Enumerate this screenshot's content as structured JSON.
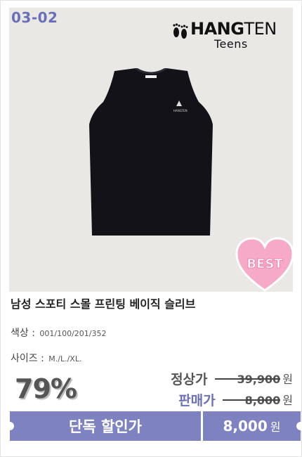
{
  "product": {
    "code": "03-02",
    "brand": {
      "main_prefix": "HANG",
      "main_suffix": "TEN",
      "sub": "Teens"
    },
    "badge": "BEST",
    "shirt_tag": "HANGTEN",
    "title": "남성 스포티 스몰 프린팅 베이직 슬리브",
    "color_label": "색상 :",
    "color_value": "001/100/201/352",
    "size_label": "사이즈 :",
    "size_value": "M./L./XL."
  },
  "pricing": {
    "discount": "79%",
    "regular_label": "정상가",
    "regular_price": "39,900",
    "sale_label": "판매가",
    "sale_price": "8,000",
    "currency": "원"
  },
  "cta": {
    "label": "단독 할인가",
    "price": "8,000",
    "currency": "원"
  },
  "colors": {
    "accent": "#7e82c1",
    "code_text": "#6a6fb7",
    "badge_pink": "#f7a9c8",
    "shirt": "#121218",
    "photo_bg": "#e9e8e5"
  }
}
